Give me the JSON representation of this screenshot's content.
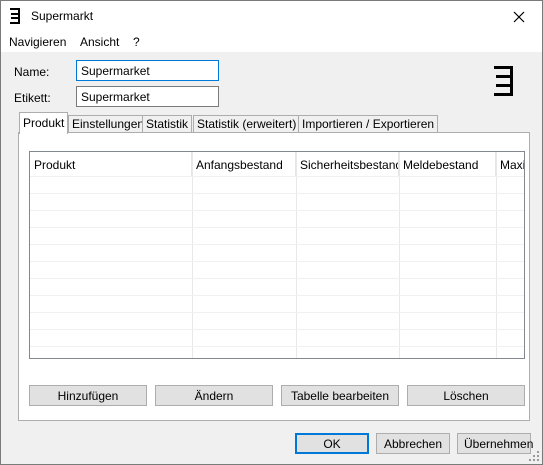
{
  "window": {
    "title": "Supermarkt",
    "app_icon": "bars-bracket-icon",
    "close_icon": "close-icon"
  },
  "menu": {
    "items": [
      "Navigieren",
      "Ansicht",
      "?"
    ]
  },
  "form": {
    "name_label": "Name:",
    "name_value": "Supermarket",
    "etikett_label": "Etikett:",
    "etikett_value": "Supermarket"
  },
  "tabs": [
    {
      "label": "Produkt",
      "active": true
    },
    {
      "label": "Einstellungen",
      "active": false
    },
    {
      "label": "Statistik",
      "active": false
    },
    {
      "label": "Statistik (erweitert)",
      "active": false
    },
    {
      "label": "Importieren / Exportieren",
      "active": false
    }
  ],
  "table": {
    "columns": [
      "Produkt",
      "Anfangsbestand",
      "Sicherheitsbestand",
      "Meldebestand",
      "Maxim"
    ],
    "rows": []
  },
  "table_buttons": {
    "add": "Hinzufügen",
    "edit": "Ändern",
    "edit_table": "Tabelle bearbeiten",
    "delete": "Löschen"
  },
  "dialog_buttons": {
    "ok": "OK",
    "cancel": "Abbrechen",
    "apply": "Übernehmen"
  },
  "colors": {
    "accent": "#0078d7",
    "window_bg": "#f0f0f0",
    "button_bg": "#e1e1e1"
  }
}
